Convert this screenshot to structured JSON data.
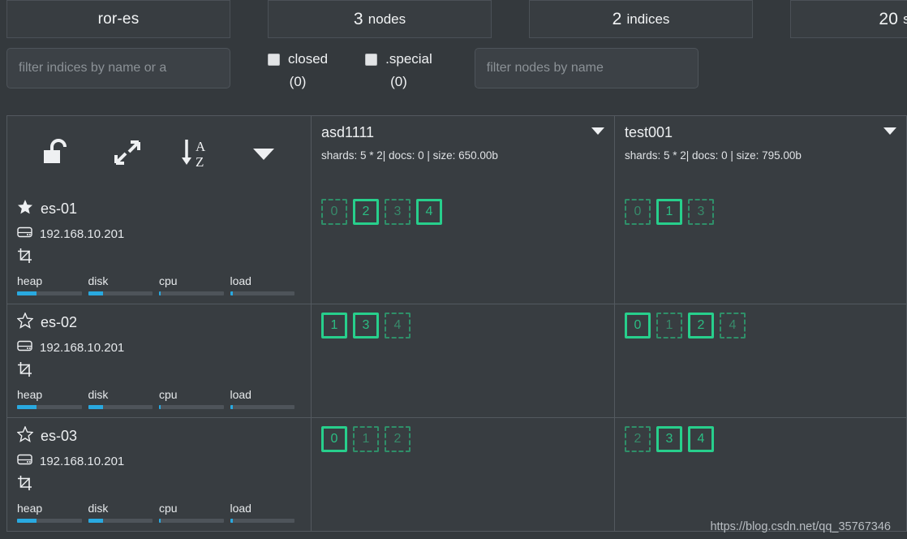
{
  "stats": [
    {
      "value": "ror-es",
      "unit": "",
      "name": "cluster-name"
    },
    {
      "value": "3",
      "unit": "nodes",
      "name": "nodes"
    },
    {
      "value": "2",
      "unit": "indices",
      "name": "indices"
    },
    {
      "value": "20",
      "unit": "sha",
      "name": "shards"
    }
  ],
  "filters": {
    "indices_placeholder": "filter indices by name or a",
    "indices_value": "",
    "nodes_placeholder": "filter nodes by name",
    "nodes_value": "",
    "closed": {
      "label": "closed",
      "count": "(0)",
      "checked": false
    },
    "special": {
      "label": ".special",
      "count": "(0)",
      "checked": false
    }
  },
  "toolbar": {
    "icons": [
      {
        "name": "unlock-icon",
        "title": "unlock"
      },
      {
        "name": "expand-arrows-icon",
        "title": "expand"
      },
      {
        "name": "sort-alpha-asc-icon",
        "title": "sort A-Z"
      },
      {
        "name": "chevron-down-icon",
        "title": "more"
      }
    ]
  },
  "indices": [
    {
      "name": "asd1111",
      "meta": "shards: 5 * 2| docs: 0 | size: 650.00b"
    },
    {
      "name": "test001",
      "meta": "shards: 5 * 2| docs: 0 | size: 795.00b"
    }
  ],
  "nodes": [
    {
      "name": "es-01",
      "ip": "192.168.10.201",
      "master": true,
      "star_icon": "star-filled-icon",
      "metrics": [
        {
          "label": "heap",
          "pct": 30
        },
        {
          "label": "disk",
          "pct": 23
        },
        {
          "label": "cpu",
          "pct": 2
        },
        {
          "label": "load",
          "pct": 4
        }
      ],
      "shards": [
        [
          {
            "id": "0",
            "type": "replica"
          },
          {
            "id": "2",
            "type": "primary"
          },
          {
            "id": "3",
            "type": "replica"
          },
          {
            "id": "4",
            "type": "primary"
          }
        ],
        [
          {
            "id": "0",
            "type": "replica"
          },
          {
            "id": "1",
            "type": "primary"
          },
          {
            "id": "3",
            "type": "replica"
          }
        ]
      ]
    },
    {
      "name": "es-02",
      "ip": "192.168.10.201",
      "master": false,
      "star_icon": "star-outline-icon",
      "metrics": [
        {
          "label": "heap",
          "pct": 30
        },
        {
          "label": "disk",
          "pct": 23
        },
        {
          "label": "cpu",
          "pct": 2
        },
        {
          "label": "load",
          "pct": 4
        }
      ],
      "shards": [
        [
          {
            "id": "1",
            "type": "primary"
          },
          {
            "id": "3",
            "type": "primary"
          },
          {
            "id": "4",
            "type": "replica"
          }
        ],
        [
          {
            "id": "0",
            "type": "primary"
          },
          {
            "id": "1",
            "type": "replica"
          },
          {
            "id": "2",
            "type": "primary"
          },
          {
            "id": "4",
            "type": "replica"
          }
        ]
      ]
    },
    {
      "name": "es-03",
      "ip": "192.168.10.201",
      "master": false,
      "star_icon": "star-outline-icon",
      "metrics": [
        {
          "label": "heap",
          "pct": 30
        },
        {
          "label": "disk",
          "pct": 23
        },
        {
          "label": "cpu",
          "pct": 2
        },
        {
          "label": "load",
          "pct": 4
        }
      ],
      "shards": [
        [
          {
            "id": "0",
            "type": "primary"
          },
          {
            "id": "1",
            "type": "replica"
          },
          {
            "id": "2",
            "type": "replica"
          }
        ],
        [
          {
            "id": "2",
            "type": "replica"
          },
          {
            "id": "3",
            "type": "primary"
          },
          {
            "id": "4",
            "type": "primary"
          }
        ]
      ]
    }
  ],
  "watermark": "https://blog.csdn.net/qq_35767346",
  "colors": {
    "page_bg": "#34393d",
    "panel_bg": "#383d41",
    "border": "#53595f",
    "primary_shard": "#27cf8c",
    "replica_shard": "#2f8f69",
    "metric_fill": "#29a9e0"
  }
}
